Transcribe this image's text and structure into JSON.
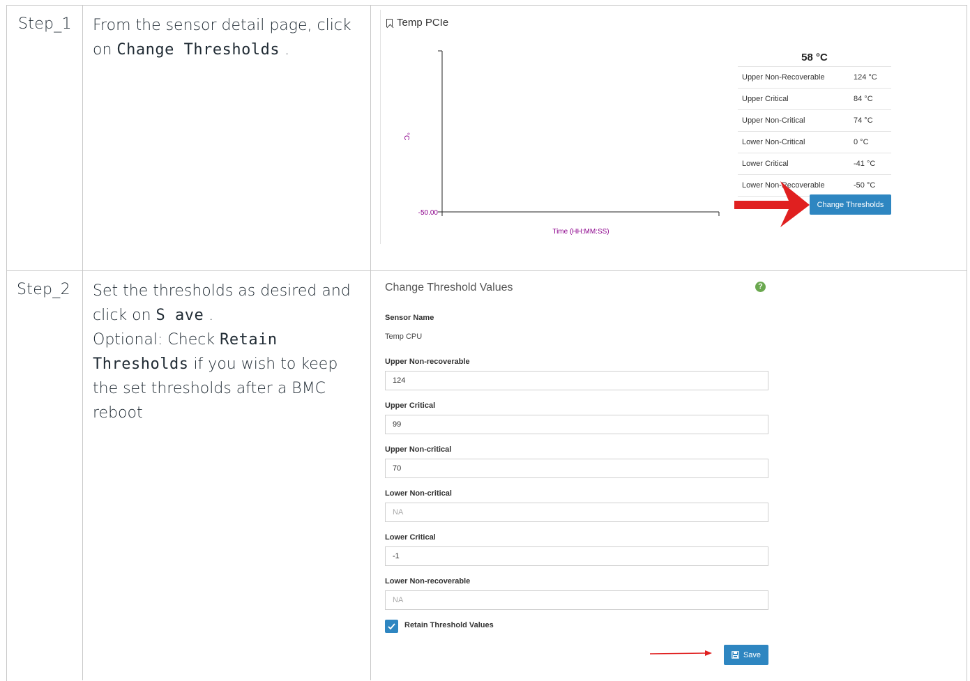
{
  "steps": [
    {
      "label": "Step_1",
      "desc": [
        "From the sensor detail page, click",
        "on ",
        "Change Thresholds",
        " ."
      ]
    },
    {
      "label": "Step_2",
      "desc": [
        "Set the thresholds as desired and",
        "click on ",
        "S ave",
        " .",
        "Optional: Check ",
        "Retain",
        "Thresholds",
        " if you wish to keep",
        "the set thresholds after a BMC",
        "reboot"
      ]
    }
  ],
  "sensor_panel": {
    "title": "Temp PCIe",
    "icon": "bookmark-icon",
    "current_value": "58 °C",
    "y_unit": "°C",
    "y_tick": "-50.00",
    "x_label": "Time (HH:MM:SS)",
    "thresholds": [
      {
        "name": "Upper Non-Recoverable",
        "value": "124 °C"
      },
      {
        "name": "Upper Critical",
        "value": "84 °C"
      },
      {
        "name": "Upper Non-Critical",
        "value": "74 °C"
      },
      {
        "name": "Lower Non-Critical",
        "value": "0 °C"
      },
      {
        "name": "Lower Critical",
        "value": "-41 °C"
      },
      {
        "name": "Lower Non-Recoverable",
        "value": "-50 °C"
      }
    ],
    "change_button": "Change Thresholds"
  },
  "threshold_form": {
    "title": "Change Threshold Values",
    "sensor_name_label": "Sensor Name",
    "sensor_name": "Temp CPU",
    "fields": [
      {
        "label": "Upper Non-recoverable",
        "value": "124",
        "disabled": false
      },
      {
        "label": "Upper Critical",
        "value": "99",
        "disabled": false
      },
      {
        "label": "Upper Non-critical",
        "value": "70",
        "disabled": false
      },
      {
        "label": "Lower Non-critical",
        "value": "NA",
        "disabled": true
      },
      {
        "label": "Lower Critical",
        "value": "-1",
        "disabled": false
      },
      {
        "label": "Lower Non-recoverable",
        "value": "NA",
        "disabled": true
      }
    ],
    "retain_label": "Retain Threshold Values",
    "retain_checked": true,
    "save_label": "Save"
  },
  "colors": {
    "accent": "#2e86c1",
    "arrow": "#e02020",
    "chart_text": "#8b008b",
    "help": "#6aa84f"
  }
}
